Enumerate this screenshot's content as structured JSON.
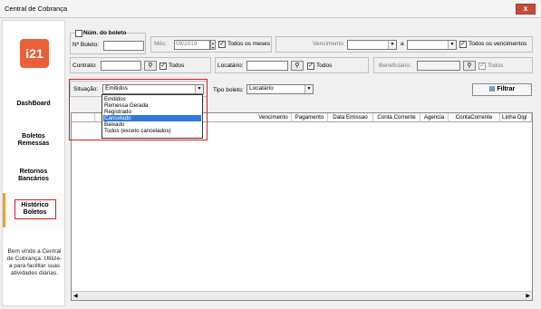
{
  "window": {
    "title": "Central de Cobrança",
    "close_label": "x"
  },
  "sidebar": {
    "logo": "i21",
    "items": [
      {
        "label": "DashBoard"
      },
      {
        "label": "Boletos Remessas"
      },
      {
        "label": "Retornos Bancários"
      },
      {
        "label": "Histórico Boletos"
      }
    ],
    "welcome": "Bem vindo a Central de Cobrança. Utilize-a para facilitar suas atividades diárias."
  },
  "filters": {
    "num_boleto_label": "Núm. do boleto",
    "nboleto_label": "Nº Boleto:",
    "nboleto_value": "",
    "mes_label": "Mês:",
    "mes_value": "09/2019",
    "todos_meses_label": "Todos os meses",
    "vencimento_label": "Vencimento",
    "a_label": "a",
    "todos_vencimentos_label": "Todos os vencimentos",
    "contrato_label": "Contrato:",
    "todos1": "Todos",
    "locatario_label": "Locatário:",
    "todos2": "Todos",
    "beneficiario_label": "Beneficiário:",
    "todos3": "Todos",
    "situacao_label": "Situação:",
    "situacao_value": "Emitidos",
    "tipo_boleto_label": "Tipo boleto:",
    "tipo_boleto_value": "Locatário",
    "filtrar_label": "Filtrar"
  },
  "dropdown": {
    "options": [
      "Emitidos",
      "Remessa Gerada",
      "Registrado",
      "Cancelado",
      "Baixado",
      "Todos (exceto cancelados)"
    ],
    "selected_index": 3
  },
  "grid": {
    "columns": [
      "Vencimento",
      "Pagamento",
      "Data Emissao",
      "Conta Corrente",
      "Agencia",
      "ContaCorrente",
      "Linha Digi"
    ]
  },
  "colors": {
    "accent": "#e8613a",
    "highlight": "#d81e1e",
    "selection": "#3179d8"
  }
}
